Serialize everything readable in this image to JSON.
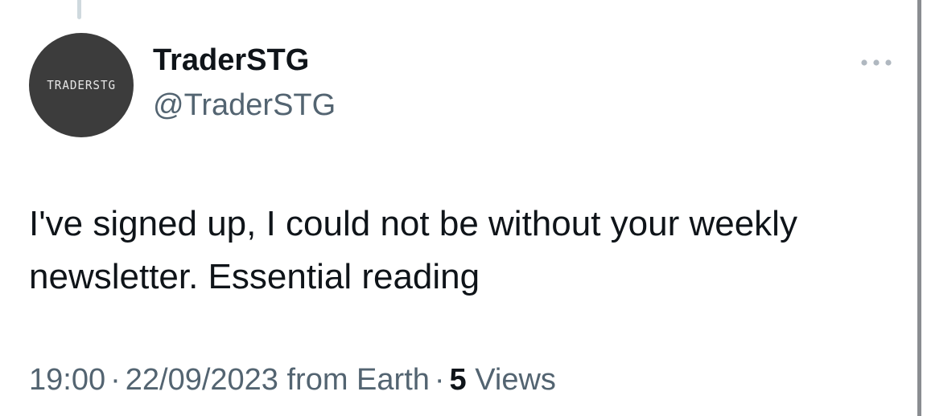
{
  "tweet": {
    "avatar_text": "TRADERSTG",
    "display_name": "TraderSTG",
    "handle": "@TraderSTG",
    "more_icon": "more-horizontal-icon",
    "text": "I've signed up, I could not be without your weekly newsletter. Essential reading",
    "time": "19:00",
    "date": "22/09/2023",
    "source": "from Earth",
    "separator": "·",
    "views_count": "5",
    "views_label": "Views"
  },
  "colors": {
    "text_primary": "#0f1419",
    "text_secondary": "#536471",
    "avatar_bg": "#3c3c3c",
    "thread_line": "#cfd9de"
  }
}
